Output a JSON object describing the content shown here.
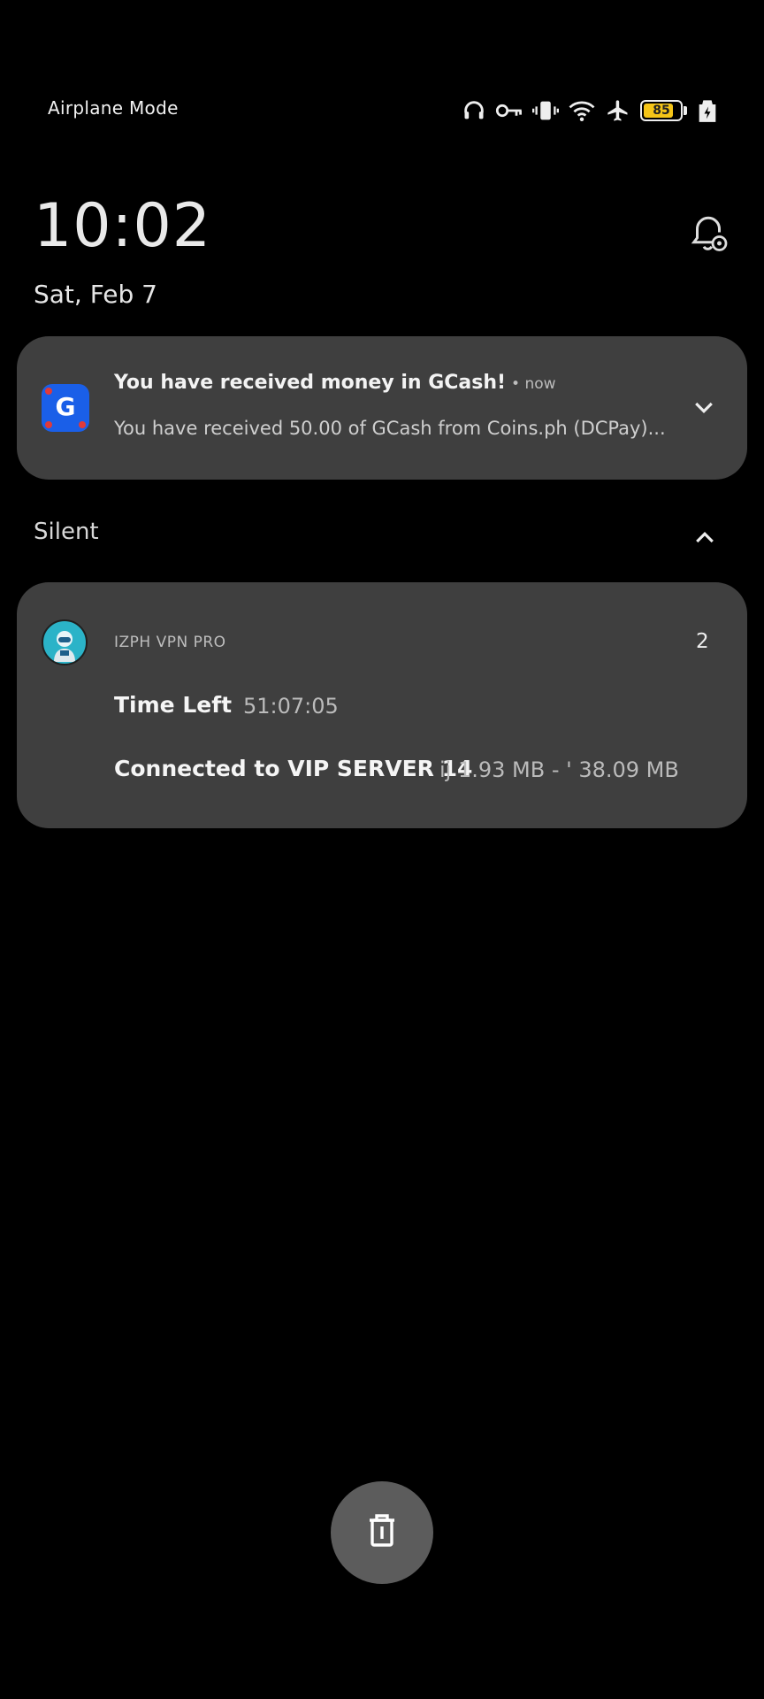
{
  "status_bar": {
    "left_text": "Airplane Mode",
    "icons": [
      "headphones-icon",
      "key-icon",
      "vibrate-icon",
      "wifi-icon",
      "airplane-icon",
      "battery-icon",
      "charging-icon"
    ],
    "battery_percent": "85",
    "battery_level": 0.85,
    "battery_color": "#f5c518"
  },
  "lockscreen": {
    "time": "10:02",
    "date": "Sat, Feb 7"
  },
  "notifications": {
    "gcash": {
      "title": "You have received money in GCash!",
      "time": "• now",
      "text": "You have received 50.00 of GCash from Coins.ph (DCPay)..."
    },
    "silent_section": {
      "label": "Silent"
    },
    "vpn": {
      "app_name": "IZPH VPN PRO",
      "count": "2",
      "time_left_label": "Time Left",
      "time_left_value": "51:07:05",
      "connected_text": "Connected to VIP SERVER 14",
      "usage_text": "ij 1.93 MB - ' 38.09 MB"
    }
  },
  "colors": {
    "background": "#000000",
    "card": "#3f3f3f",
    "gcash_blue": "#1a5fe8",
    "clear_button": "#5c5c5c"
  }
}
